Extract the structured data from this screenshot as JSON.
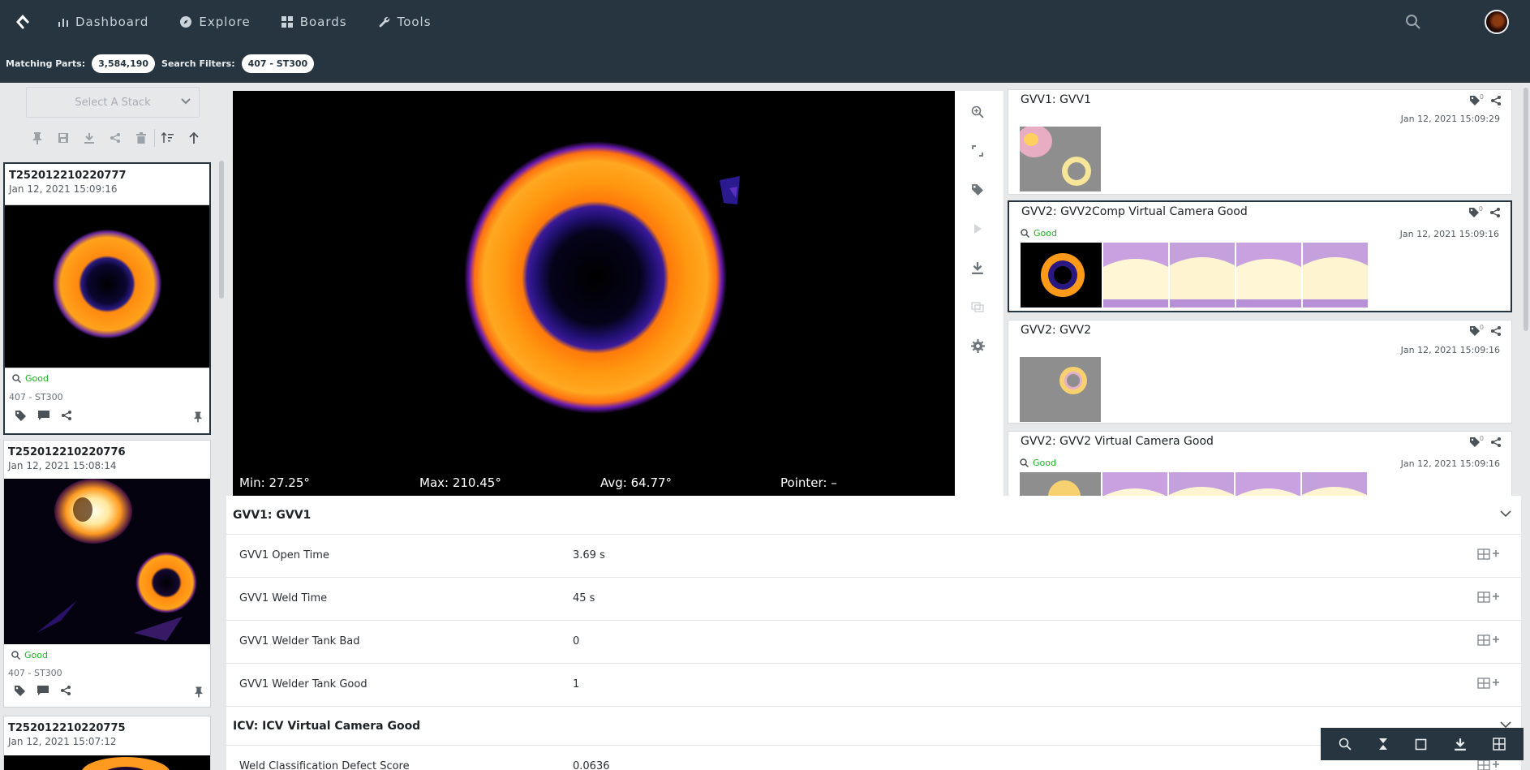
{
  "nav": {
    "items": [
      {
        "label": "Dashboard",
        "icon": "bar-chart-icon"
      },
      {
        "label": "Explore",
        "icon": "compass-icon"
      },
      {
        "label": "Boards",
        "icon": "grid-icon"
      },
      {
        "label": "Tools",
        "icon": "wrench-icon"
      }
    ]
  },
  "filters": {
    "matching_label": "Matching Parts:",
    "matching_value": "3,584,190",
    "search_label": "Search Filters:",
    "search_value": "407 - ST300"
  },
  "stack_select": {
    "placeholder": "Select A Stack"
  },
  "parts": [
    {
      "id": "T252012210220777",
      "date": "Jan 12, 2021 15:09:16",
      "result": "Good",
      "station": "407 - ST300"
    },
    {
      "id": "T252012210220776",
      "date": "Jan 12, 2021 15:08:14",
      "result": "Good",
      "station": "407 - ST300"
    },
    {
      "id": "T252012210220775",
      "date": "Jan 12, 2021 15:07:12"
    }
  ],
  "viewer": {
    "min": "Min: 27.25°",
    "max": "Max: 210.45°",
    "avg": "Avg: 64.77°",
    "pointer": "Pointer: –"
  },
  "captures": [
    {
      "title": "GVV1: GVV1",
      "date": "Jan 12, 2021 15:09:29",
      "tag_count": "0"
    },
    {
      "title": "GVV2: GVV2Comp Virtual Camera Good",
      "date": "Jan 12, 2021 15:09:16",
      "result": "Good",
      "tag_count": "0"
    },
    {
      "title": "GVV2: GVV2",
      "date": "Jan 12, 2021 15:09:16",
      "tag_count": "0"
    },
    {
      "title": "GVV2: GVV2 Virtual Camera Good",
      "date": "Jan 12, 2021 15:09:16",
      "result": "Good",
      "tag_count": "0"
    }
  ],
  "details": {
    "sections": [
      {
        "title": "GVV1: GVV1"
      },
      {
        "title": "ICV: ICV Virtual Camera Good"
      }
    ],
    "rows": [
      {
        "key": "GVV1 Open Time",
        "value": "3.69 s"
      },
      {
        "key": "GVV1 Weld Time",
        "value": "45 s"
      },
      {
        "key": "GVV1 Welder Tank Bad",
        "value": "0"
      },
      {
        "key": "GVV1 Welder Tank Good",
        "value": "1"
      },
      {
        "key": "Weld Classification Defect Score",
        "value": "0.0636"
      }
    ]
  },
  "colors": {
    "topbar": "#263540",
    "good": "#22b222",
    "accent_orange": "#ff9a12"
  }
}
